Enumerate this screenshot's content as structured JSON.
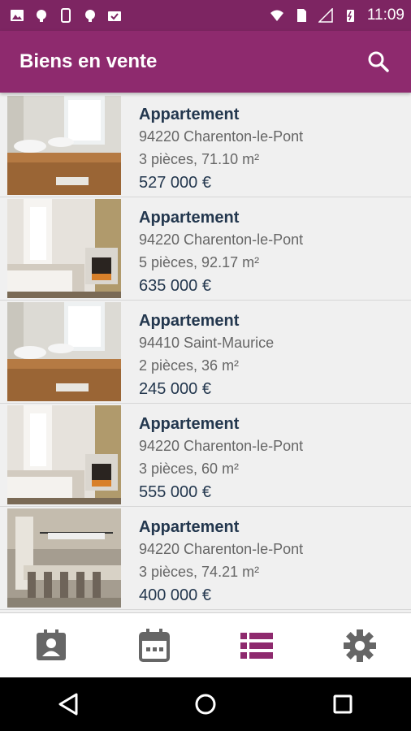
{
  "status_bar": {
    "time": "11:09",
    "left_icons": [
      "image-icon",
      "android-icon",
      "phone-icon",
      "android-icon",
      "briefcase-check-icon"
    ],
    "right_icons": [
      "wifi-icon",
      "sim-icon",
      "signal-icon",
      "battery-charging-icon"
    ]
  },
  "app_bar": {
    "title": "Biens en vente",
    "search_icon": "search-icon"
  },
  "listings": [
    {
      "type": "Appartement",
      "location": "94220 Charenton-le-Pont",
      "details": "3 pièces, 71.10 m²",
      "price": "527 000 €",
      "image": "bathroom"
    },
    {
      "type": "Appartement",
      "location": "94220 Charenton-le-Pont",
      "details": "5 pièces, 92.17 m²",
      "price": "635 000 €",
      "image": "bedroom"
    },
    {
      "type": "Appartement",
      "location": "94410 Saint-Maurice",
      "details": "2 pièces, 36 m²",
      "price": "245 000 €",
      "image": "bathroom"
    },
    {
      "type": "Appartement",
      "location": "94220 Charenton-le-Pont",
      "details": "3 pièces, 60 m²",
      "price": "555 000 €",
      "image": "bedroom"
    },
    {
      "type": "Appartement",
      "location": "94220 Charenton-le-Pont",
      "details": "3 pièces, 74.21 m²",
      "price": "400 000 €",
      "image": "dining"
    }
  ],
  "bottom_nav": {
    "items": [
      {
        "icon": "contacts-icon",
        "active": false
      },
      {
        "icon": "calendar-icon",
        "active": false
      },
      {
        "icon": "list-icon",
        "active": true
      },
      {
        "icon": "gear-icon",
        "active": false
      }
    ]
  },
  "colors": {
    "status_bar": "#7d2562",
    "app_bar": "#8e2a6e",
    "accent": "#8e2a6e",
    "title_text": "#23374e",
    "inactive_icon": "#666666"
  }
}
